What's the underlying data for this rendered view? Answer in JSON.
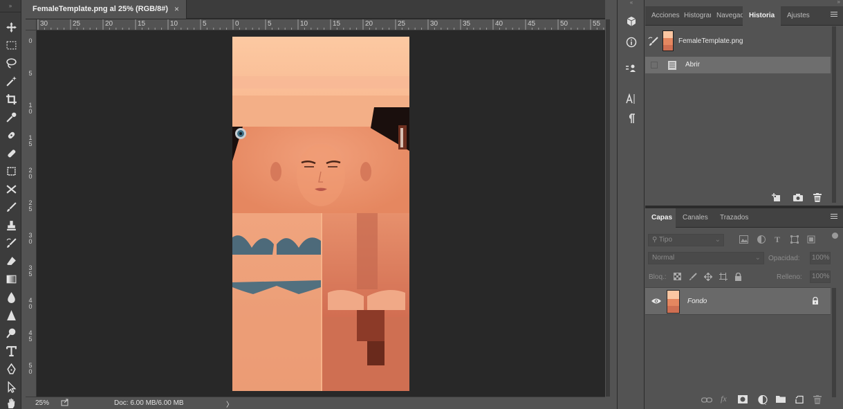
{
  "document": {
    "tab_title": "FemaleTemplate.png al 25% (RGB/8#)",
    "tab_close": "×"
  },
  "rulers": {
    "horizontal": [
      "30",
      "25",
      "20",
      "15",
      "10",
      "5",
      "0",
      "5",
      "10",
      "15",
      "20",
      "25",
      "30",
      "35",
      "40",
      "45",
      "50",
      "55"
    ],
    "vertical": [
      "0",
      "5",
      "1 0",
      "1 5",
      "2 0",
      "2 5",
      "3 0",
      "3 5",
      "4 0",
      "4 5",
      "5 0"
    ]
  },
  "status": {
    "zoom": "25%",
    "doc_info": "Doc: 6.00 MB/6.00 MB",
    "arrow": "〉"
  },
  "tools": [
    {
      "name": "move-tool-icon"
    },
    {
      "name": "marquee-tool-icon"
    },
    {
      "name": "lasso-tool-icon"
    },
    {
      "name": "magic-wand-tool-icon"
    },
    {
      "name": "crop-tool-icon"
    },
    {
      "name": "eyedropper-tool-icon"
    },
    {
      "name": "spot-healing-tool-icon"
    },
    {
      "name": "brush-tool-icon"
    },
    {
      "name": "clone-stamp-tool-icon"
    },
    {
      "name": "history-brush-tool-icon"
    },
    {
      "name": "eraser-tool-icon"
    },
    {
      "name": "gradient-tool-icon"
    },
    {
      "name": "blur-tool-icon"
    },
    {
      "name": "dodge-tool-icon"
    },
    {
      "name": "pen-tool-icon"
    },
    {
      "name": "type-tool-icon"
    },
    {
      "name": "path-selection-tool-icon"
    },
    {
      "name": "shape-tool-icon"
    },
    {
      "name": "hand-tool-icon"
    }
  ],
  "history_panel": {
    "tabs": [
      "Acciones",
      "Histograma",
      "Navegador",
      "Historia",
      "Ajustes"
    ],
    "active_tab": "Historia",
    "source_name": "FemaleTemplate.png",
    "states": [
      {
        "label": "Abrir"
      }
    ]
  },
  "layers_panel": {
    "tabs": [
      "Capas",
      "Canales",
      "Trazados"
    ],
    "active_tab": "Capas",
    "filter_placeholder": "Tipo",
    "blend_mode": "Normal",
    "opacity_label": "Opacidad:",
    "opacity_value": "100%",
    "lock_label": "Bloq.:",
    "fill_label": "Relleno:",
    "fill_value": "100%",
    "layers": [
      {
        "name": "Fondo"
      }
    ]
  },
  "colors": {
    "panel": "#535353",
    "dark_panel": "#424242",
    "canvas_bg": "#282828",
    "selected_row": "#696969"
  }
}
